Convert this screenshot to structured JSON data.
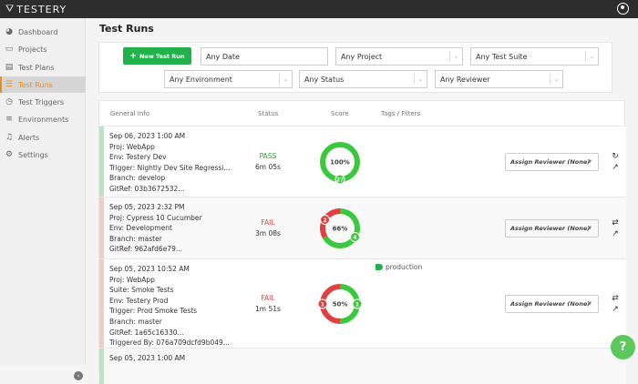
{
  "app": {
    "name": "TESTERY"
  },
  "sidebar": {
    "items": [
      {
        "label": "Dashboard",
        "icon": "dashboard-icon",
        "glyph": "◕"
      },
      {
        "label": "Projects",
        "icon": "folder-icon",
        "glyph": "▭"
      },
      {
        "label": "Test Plans",
        "icon": "clipboard-icon",
        "glyph": "▤"
      },
      {
        "label": "Test Runs",
        "icon": "list-icon",
        "glyph": "☰",
        "active": true
      },
      {
        "label": "Test Triggers",
        "icon": "clock-icon",
        "glyph": "◷"
      },
      {
        "label": "Environments",
        "icon": "server-icon",
        "glyph": "≡"
      },
      {
        "label": "Alerts",
        "icon": "bell-icon",
        "glyph": "♫"
      },
      {
        "label": "Settings",
        "icon": "gears-icon",
        "glyph": "⚙"
      }
    ]
  },
  "page": {
    "title": "Test Runs"
  },
  "filters": {
    "new_button": "New Test Run",
    "date": "Any Date",
    "project": "Any Project",
    "suite": "Any Test Suite",
    "environment": "Any Environment",
    "status": "Any Status",
    "reviewer": "Any Reviewer"
  },
  "table": {
    "headers": [
      "General Info",
      "Status",
      "Score",
      "Tags / Filters"
    ],
    "rows": [
      {
        "lines": [
          "Sep 06, 2023 1:00 AM",
          "Proj: WebApp",
          "Env: Testery Dev",
          "Trigger: Nightly Dev Site Regressi...",
          "Branch: develop",
          "GitRef: 03b3672532..."
        ],
        "status": "PASS",
        "duration": "6m 05s",
        "score": "100%",
        "passed": 27,
        "failed": 0,
        "tags": [],
        "reviewer": "Assign Reviewer (None)",
        "color": "#b9e5c3"
      },
      {
        "lines": [
          "Sep 05, 2023 2:32 PM",
          "Proj: Cypress 10 Cucumber",
          "Env: Development",
          "Branch: master",
          "GitRef: 962afd6e79..."
        ],
        "status": "FAIL",
        "duration": "3m 08s",
        "score": "66%",
        "passed": 4,
        "failed": 2,
        "tags": [],
        "reviewer": "Assign Reviewer (None)",
        "color": "#f5c9cc"
      },
      {
        "lines": [
          "Sep 05, 2023 10:52 AM",
          "Proj: WebApp",
          "Suite: Smoke Tests",
          "Env: Testery Prod",
          "Trigger: Prod Smoke Tests",
          "Branch: master",
          "GitRef: 1a65c16330...",
          "Triggered By: 076a709dcfd9b049..."
        ],
        "status": "FAIL",
        "duration": "1m 51s",
        "score": "50%",
        "passed": 1,
        "failed": 1,
        "tags": [
          "production"
        ],
        "reviewer": "Assign Reviewer (None)",
        "color": "#f5c9cc"
      },
      {
        "lines": [
          "Sep 05, 2023 1:00 AM"
        ],
        "status": "",
        "duration": "",
        "score": "",
        "passed": 0,
        "failed": 0,
        "tags": [],
        "reviewer": "",
        "color": "#b9e5c3"
      }
    ]
  },
  "colors": {
    "pass": "#3cc83c",
    "fail": "#e04040",
    "accent": "#f08c1e"
  },
  "help": {
    "label": "?"
  }
}
